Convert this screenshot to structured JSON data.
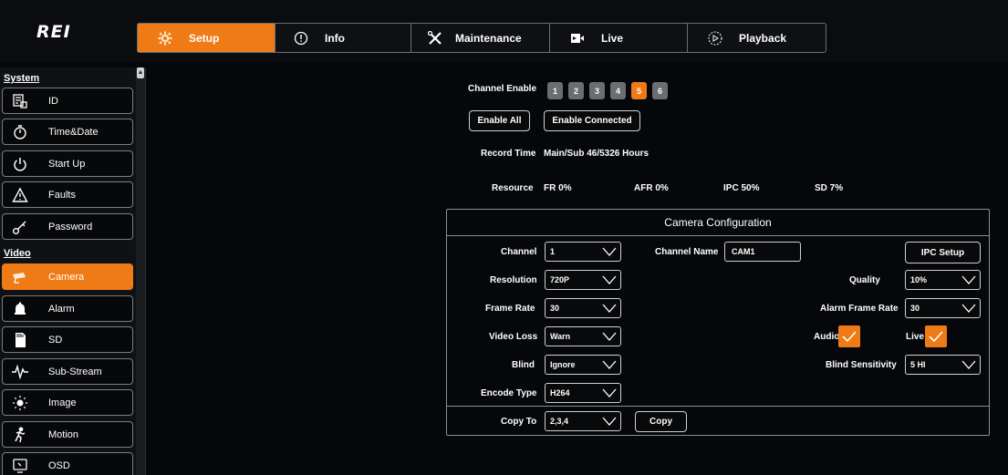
{
  "header": {
    "logo": "REI",
    "tabs": [
      {
        "label": "Setup",
        "icon": "gear-icon",
        "active": true
      },
      {
        "label": "Info",
        "icon": "info-icon",
        "active": false
      },
      {
        "label": "Maintenance",
        "icon": "tools-icon",
        "active": false
      },
      {
        "label": "Live",
        "icon": "live-camera-icon",
        "active": false
      },
      {
        "label": "Playback",
        "icon": "playback-icon",
        "active": false
      }
    ]
  },
  "sidebar": {
    "system_title": "System",
    "video_title": "Video",
    "system_items": [
      {
        "label": "ID",
        "icon": "id-icon"
      },
      {
        "label": "Time&Date",
        "icon": "stopwatch-icon"
      },
      {
        "label": "Start Up",
        "icon": "power-icon"
      },
      {
        "label": "Faults",
        "icon": "warning-icon"
      },
      {
        "label": "Password",
        "icon": "key-icon"
      }
    ],
    "video_items": [
      {
        "label": "Camera",
        "icon": "camera-icon",
        "active": true
      },
      {
        "label": "Alarm",
        "icon": "bell-icon"
      },
      {
        "label": "SD",
        "icon": "sd-card-icon"
      },
      {
        "label": "Sub-Stream",
        "icon": "waveform-icon"
      },
      {
        "label": "Image",
        "icon": "brightness-icon"
      },
      {
        "label": "Motion",
        "icon": "motion-icon"
      },
      {
        "label": "OSD",
        "icon": "osd-icon"
      }
    ]
  },
  "channel_enable": {
    "label": "Channel Enable",
    "channels": [
      "1",
      "2",
      "3",
      "4",
      "5",
      "6"
    ],
    "selected": "5",
    "enable_all": "Enable All",
    "enable_connected": "Enable Connected"
  },
  "record_time": {
    "label": "Record Time",
    "value": "Main/Sub  46/5326  Hours"
  },
  "resource": {
    "label": "Resource",
    "fr": "FR  0%",
    "afr": "AFR  0%",
    "ipc": "IPC  50%",
    "sd": "SD  7%"
  },
  "camera_config": {
    "title": "Camera Configuration",
    "channel_label": "Channel",
    "channel_value": "1",
    "channel_name_label": "Channel Name",
    "channel_name_value": "CAM1",
    "ipc_setup": "IPC Setup",
    "resolution_label": "Resolution",
    "resolution_value": "720P",
    "quality_label": "Quality",
    "quality_value": "10%",
    "frame_rate_label": "Frame Rate",
    "frame_rate_value": "30",
    "alarm_frame_rate_label": "Alarm Frame Rate",
    "alarm_frame_rate_value": "30",
    "video_loss_label": "Video Loss",
    "video_loss_value": "Warn",
    "audio_label": "Audio",
    "audio_checked": true,
    "live_label": "Live",
    "live_checked": true,
    "blind_label": "Blind",
    "blind_value": "Ignore",
    "blind_sensitivity_label": "Blind Sensitivity",
    "blind_sensitivity_value": "5 HI",
    "encode_type_label": "Encode Type",
    "encode_type_value": "H264",
    "copy_to_label": "Copy To",
    "copy_to_value": "2,3,4",
    "copy_button": "Copy"
  },
  "colors": {
    "accent": "#ef7b16",
    "background": "#05070a",
    "border": "#d0d0d0"
  }
}
